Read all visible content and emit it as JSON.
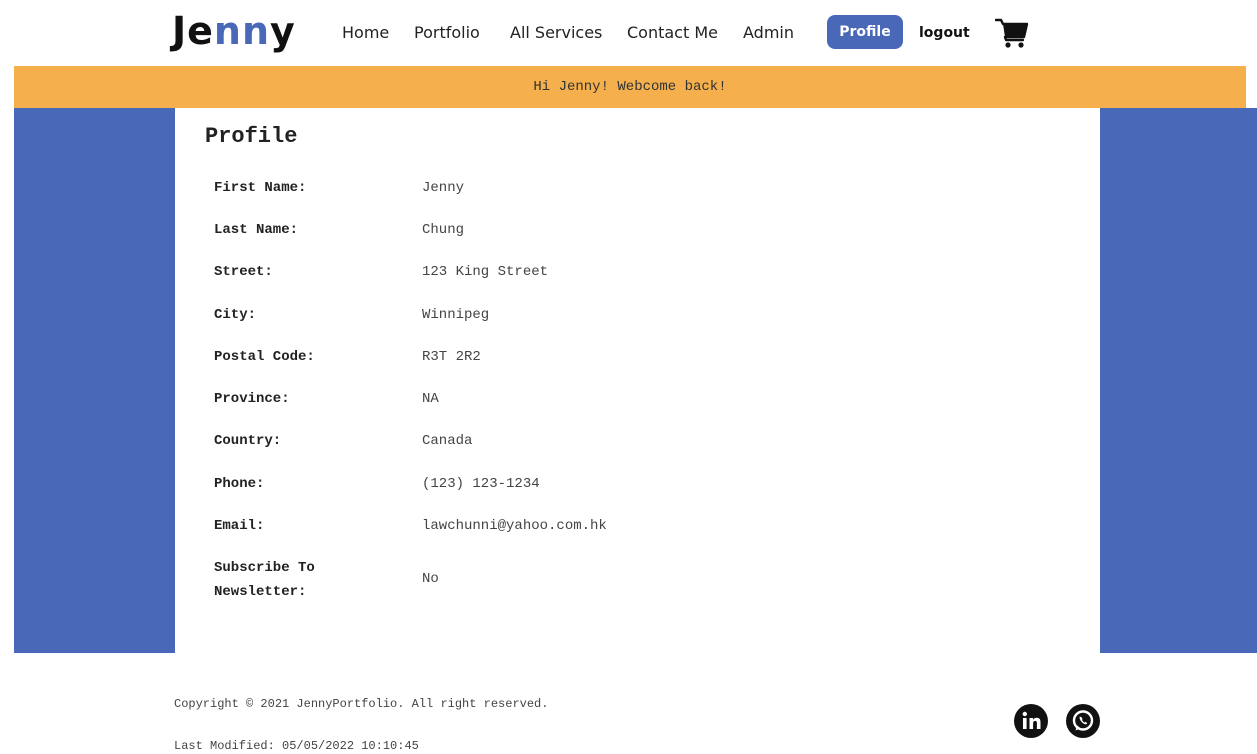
{
  "header": {
    "logo_prefix": "Je",
    "logo_mid": "nn",
    "logo_suffix": "y",
    "nav": {
      "home": "Home",
      "portfolio": "Portfolio",
      "services": "All Services",
      "contact": "Contact Me",
      "admin": "Admin"
    },
    "profile_label": "Profile",
    "logout_label": "logout",
    "cart_icon": "shopping-cart-icon"
  },
  "banner": {
    "message": "Hi Jenny! Webcome back!"
  },
  "profile": {
    "title": "Profile",
    "fields": [
      {
        "label": "First Name:",
        "value": "Jenny"
      },
      {
        "label": "Last Name:",
        "value": "Chung"
      },
      {
        "label": "Street:",
        "value": "123 King Street"
      },
      {
        "label": "City:",
        "value": "Winnipeg"
      },
      {
        "label": "Postal Code:",
        "value": "R3T 2R2"
      },
      {
        "label": "Province:",
        "value": "NA"
      },
      {
        "label": "Country:",
        "value": "Canada"
      },
      {
        "label": "Phone:",
        "value": "(123) 123-1234"
      },
      {
        "label": "Email:",
        "value": "lawchunni@yahoo.com.hk"
      },
      {
        "label": "Subscribe To Newsletter:",
        "value": "No"
      }
    ]
  },
  "footer": {
    "copyright": "Copyright © 2021 JennyPortfolio. All right reserved.",
    "last_modified": "Last Modified: 05/05/2022 10:10:45",
    "social_icons": [
      "linkedin-icon",
      "whatsapp-icon"
    ]
  },
  "colors": {
    "accent_blue": "#4a68b8",
    "banner_orange": "#f5b04d"
  }
}
